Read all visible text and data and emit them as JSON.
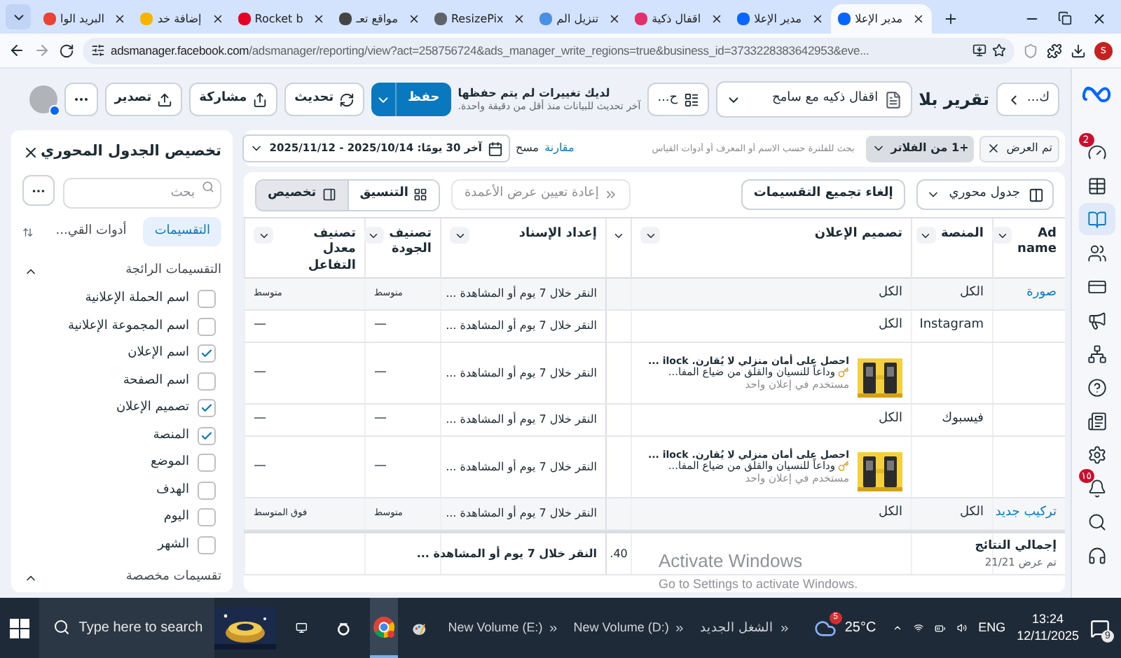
{
  "browser": {
    "tabs": [
      {
        "title": "مدير الإعلا",
        "color": "#0866ff",
        "selected": true
      },
      {
        "title": "مدير الإعلا",
        "color": "#0866ff",
        "selected": false
      },
      {
        "title": "اقفال ذكية",
        "color": "#e1306c",
        "selected": false
      },
      {
        "title": "تنزيل الم",
        "color": "#4a90e2",
        "selected": false
      },
      {
        "title": "ResizePix",
        "color": "#5f6368",
        "selected": false
      },
      {
        "title": "مواقع تعـ",
        "color": "#444444",
        "selected": false
      },
      {
        "title": "Rocket b",
        "color": "#e60023",
        "selected": false
      },
      {
        "title": "إضافة خد",
        "color": "#f4b400",
        "selected": false
      },
      {
        "title": "البريد الوا",
        "color": "#ea4335",
        "selected": false
      }
    ],
    "url_host": "adsmanager.facebook.com",
    "url_rest": "/adsmanager/reporting/view?act=258756724&ads_manager_write_regions=true&business_id=3733228383642953&eve...",
    "profile": "s"
  },
  "rail": [
    {
      "selected": false,
      "badge": "2"
    },
    {
      "selected": false
    },
    {
      "selected": true
    },
    {
      "selected": false
    },
    {
      "selected": false
    },
    {
      "selected": false
    },
    {
      "selected": false
    },
    {
      "selected": false
    },
    {
      "selected": false
    },
    {
      "selected": false
    },
    {
      "selected": false,
      "badge": "١٥"
    },
    {
      "selected": false
    },
    {
      "selected": false
    }
  ],
  "header": {
    "back_label": "ك...",
    "title": "تقرير بلا",
    "report_select": "اقفال ذكيه مع سامح",
    "more_label": "ح...",
    "unsaved": "لديك تغييرات لم يتم حفظها",
    "updated": "آخر تحديث للبيانات منذ أقل من دقيقة واحدة.",
    "save": "حفظ",
    "refresh": "تحديث",
    "share": "مشاركة",
    "export": "تصدير"
  },
  "filters": {
    "shown_chip": "تم العرض",
    "more_filters": "+1 من الفلاتر",
    "search_placeholder": "بحث للفلترة حسب الاسم أو المعرف أو أدوات القياس",
    "compare": "مقارنة",
    "clear": "مسح",
    "date_range": "آخر 30 يومًا: 2025/10/14 - 2025/11/12"
  },
  "toolbar": {
    "view_select": "جدول محوري",
    "ungroup": "إلغاء تجميع التقسيمات",
    "reset_widths": "إعادة تعيين عرض الأعمدة",
    "segments": [
      {
        "label": "التنسيق",
        "selected": false
      },
      {
        "label": "تخصيص",
        "selected": true
      }
    ]
  },
  "table": {
    "columns": [
      "Ad name",
      "المنصة",
      "تصميم الإعلان",
      "إعداد الإسناد",
      "تصنيف الجودة",
      "تصنيف معدل التفاعل"
    ],
    "rows": [
      {
        "kind": "group",
        "ad_name": "صورة",
        "platform": "الكل",
        "creative": "الكل",
        "attribution": "النقر خلال 7 يوم أو المشاهدة ...",
        "quality": "متوسط",
        "engagement": "متوسط"
      },
      {
        "kind": "plain",
        "platform": "Instagram",
        "creative": "الكل",
        "attribution": "النقر خلال 7 يوم أو المشاهدة ...",
        "quality": "—",
        "engagement": "—"
      },
      {
        "kind": "creative",
        "creative": {
          "title": "احصل على أمان منزلي لا يُقارن. ilock ...",
          "body": "وداعاً للنسيان والقلق من ضياع المفا...",
          "usage": "مستخدم في إعلان واحد"
        },
        "attribution": "النقر خلال 7 يوم أو المشاهدة ...",
        "quality": "—",
        "engagement": "—"
      },
      {
        "kind": "plain",
        "platform": "فيسبوك",
        "creative": "الكل",
        "attribution": "النقر خلال 7 يوم أو المشاهدة ...",
        "quality": "—",
        "engagement": "—"
      },
      {
        "kind": "creative",
        "creative": {
          "title": "احصل على أمان منزلي لا يُقارن. ilock ...",
          "body": "وداعاً للنسيان والقلق من ضياع المفا...",
          "usage": "مستخدم في إعلان واحد"
        },
        "attribution": "النقر خلال 7 يوم أو المشاهدة ...",
        "quality": "—",
        "engagement": "—"
      },
      {
        "kind": "group",
        "ad_name": "تركيب جديد",
        "platform": "الكل",
        "creative": "الكل",
        "attribution": "النقر خلال 7 يوم أو المشاهدة ...",
        "quality": "متوسط",
        "engagement": "فوق المتوسط"
      },
      {
        "kind": "total",
        "ad_name": "إجمالي النتائج",
        "subtitle": "تم عرض 21/21",
        "column_4": "40.",
        "attribution": "النقر خلال 7 يوم أو المشاهدة ..."
      }
    ]
  },
  "sidebar": {
    "title": "تخصيص الجدول المحوري",
    "search_placeholder": "بحث",
    "tabs": [
      {
        "label": "التقسيمات",
        "selected": true
      },
      {
        "label": "أدوات القي...",
        "selected": false
      }
    ],
    "sections": [
      {
        "title": "التقسيمات الرائجة",
        "expanded": true,
        "items": [
          {
            "label": "اسم الحملة الإعلانية",
            "checked": false
          },
          {
            "label": "اسم المجموعة الإعلانية",
            "checked": false
          },
          {
            "label": "اسم الإعلان",
            "checked": true
          },
          {
            "label": "اسم الصفحة",
            "checked": false
          },
          {
            "label": "تصميم الإعلان",
            "checked": true
          },
          {
            "label": "المنصة",
            "checked": true
          },
          {
            "label": "الموضع",
            "checked": false
          },
          {
            "label": "الهدف",
            "checked": false
          },
          {
            "label": "اليوم",
            "checked": false
          },
          {
            "label": "الشهر",
            "checked": false
          }
        ]
      },
      {
        "title": "تقسيمات مخصصة",
        "expanded": true
      }
    ]
  },
  "os_notice": {
    "title": "Activate Windows",
    "body": "Go to Settings to activate Windows."
  },
  "taskbar": {
    "search_placeholder": "Type here to search",
    "toolbars": [
      "الشغل الجديد",
      "New Volume (D:)",
      "New Volume (E:)"
    ],
    "weather_badge": "5",
    "temperature": "25°C",
    "language": "ENG",
    "time": "13:24",
    "date": "12/11/2025",
    "notification_count": "9"
  }
}
